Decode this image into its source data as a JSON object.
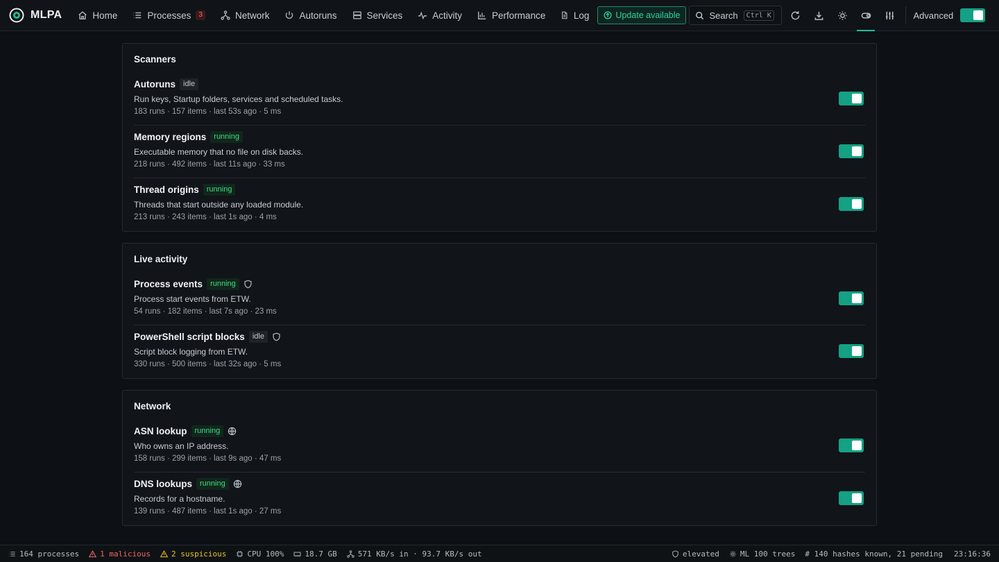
{
  "app": {
    "name": "MLPA"
  },
  "nav": {
    "home": "Home",
    "processes": "Processes",
    "processes_badge": "3",
    "network": "Network",
    "autoruns": "Autoruns",
    "services": "Services",
    "activity": "Activity",
    "performance": "Performance",
    "log": "Log"
  },
  "toolbar": {
    "update_label": "Update available",
    "search_label": "Search",
    "search_shortcut": "Ctrl K",
    "advanced_label": "Advanced",
    "advanced_enabled": true
  },
  "sections": [
    {
      "title": "Scanners",
      "items": [
        {
          "name": "Autoruns",
          "status": "idle",
          "icon": "",
          "desc": "Run keys, Startup folders, services and scheduled tasks.",
          "meta": "183 runs · 157 items · last 53s ago · 5 ms",
          "enabled": true
        },
        {
          "name": "Memory regions",
          "status": "running",
          "icon": "",
          "desc": "Executable memory that no file on disk backs.",
          "meta": "218 runs · 492 items · last 11s ago · 33 ms",
          "enabled": true
        },
        {
          "name": "Thread origins",
          "status": "running",
          "icon": "",
          "desc": "Threads that start outside any loaded module.",
          "meta": "213 runs · 243 items · last 1s ago · 4 ms",
          "enabled": true
        }
      ]
    },
    {
      "title": "Live activity",
      "items": [
        {
          "name": "Process events",
          "status": "running",
          "icon": "shield-icon",
          "desc": "Process start events from ETW.",
          "meta": "54 runs · 182 items · last 7s ago · 23 ms",
          "enabled": true
        },
        {
          "name": "PowerShell script blocks",
          "status": "idle",
          "icon": "shield-icon",
          "desc": "Script block logging from ETW.",
          "meta": "330 runs · 500 items · last 32s ago · 5 ms",
          "enabled": true
        }
      ]
    },
    {
      "title": "Network",
      "items": [
        {
          "name": "ASN lookup",
          "status": "running",
          "icon": "globe-icon",
          "desc": "Who owns an IP address.",
          "meta": "158 runs · 299 items · last 9s ago · 47 ms",
          "enabled": true
        },
        {
          "name": "DNS lookups",
          "status": "running",
          "icon": "globe-icon",
          "desc": "Records for a hostname.",
          "meta": "139 runs · 487 items · last 1s ago · 27 ms",
          "enabled": true
        }
      ]
    }
  ],
  "statusbar": {
    "processes": "164 processes",
    "malicious": "1 malicious",
    "suspicious": "2 suspicious",
    "cpu": "CPU 100%",
    "memory": "18.7 GB",
    "network": "571 KB/s in · 93.7 KB/s out",
    "elevated": "elevated",
    "ml": "ML 100 trees",
    "hashes": "# 140 hashes known, 21 pending",
    "clock": "23:16:36"
  },
  "colors": {
    "accent": "#14a184",
    "running": "#3ddc84",
    "malicious": "#f06464",
    "suspicious": "#e7c12e"
  }
}
